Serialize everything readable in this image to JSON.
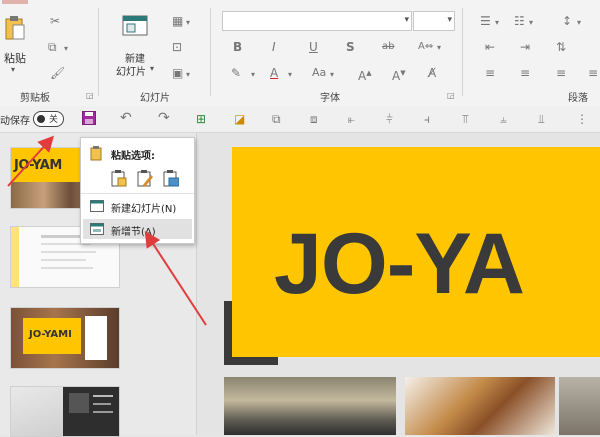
{
  "ribbon": {
    "clipboard": {
      "paste_label": "粘贴",
      "group_label": "剪贴板"
    },
    "slides": {
      "new_slide_label_1": "新建",
      "new_slide_label_2": "幻灯片",
      "group_label": "幻灯片"
    },
    "font": {
      "group_label": "字体",
      "font_name_value": "",
      "font_size_value": "",
      "aa_label": "Aa"
    },
    "paragraph": {
      "group_label": "段落"
    }
  },
  "qat": {
    "autosave_label": "动保存",
    "toggle_state": "关"
  },
  "context_menu": {
    "paste_options_label": "粘贴选项:",
    "new_slide_item": "新建幻灯片(N)",
    "new_section_item": "新增节(A)"
  },
  "slides": {
    "thumb1_title": "JO-YAM",
    "thumb3_title": "JO-YAMI",
    "main_title": "JO-YA"
  },
  "colors": {
    "accent_yellow": "#ffc600",
    "dark": "#3a3a3a",
    "annotation_red": "#e23b3b",
    "section_purple": "#a02b9e"
  }
}
